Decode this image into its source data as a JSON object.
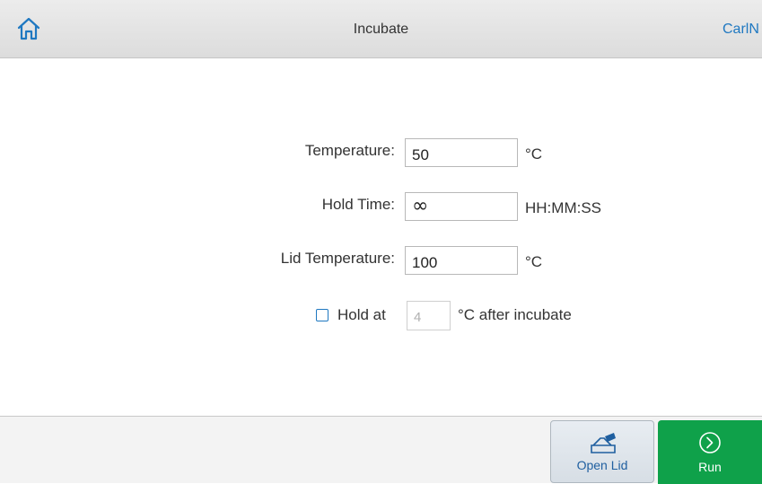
{
  "header": {
    "title": "Incubate",
    "user": "CarlN",
    "home_icon": "home-icon"
  },
  "form": {
    "temperature": {
      "label": "Temperature:",
      "value": "50",
      "unit": "°C"
    },
    "hold_time": {
      "label": "Hold Time:",
      "value": "∞",
      "unit": "HH:MM:SS"
    },
    "lid_temperature": {
      "label": "Lid Temperature:",
      "value": "100",
      "unit": "°C"
    },
    "hold_at": {
      "label": "Hold at",
      "value": "4",
      "suffix": "°C after incubate",
      "checked": false
    }
  },
  "footer": {
    "open_lid": {
      "label": "Open Lid",
      "icon": "open-lid-icon"
    },
    "run": {
      "label": "Run",
      "icon": "run-icon"
    }
  },
  "colors": {
    "accent": "#1f78c1",
    "run_green": "#0fa14a",
    "header_bg": "#e4e4e4"
  }
}
